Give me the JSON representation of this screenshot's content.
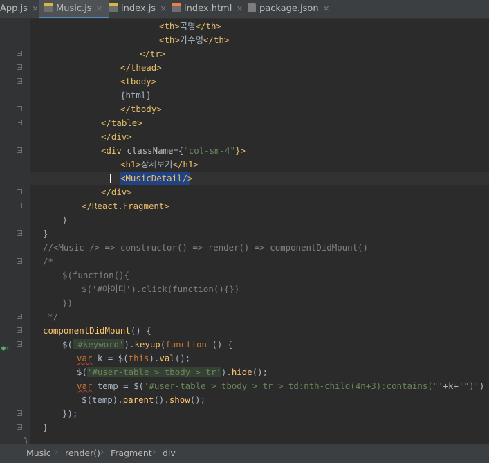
{
  "tabs": [
    {
      "label": "App.js",
      "icon": "js-file-icon",
      "active": false
    },
    {
      "label": "Music.js",
      "icon": "js-file-icon",
      "active": true
    },
    {
      "label": "index.js",
      "icon": "js-file-icon",
      "active": false
    },
    {
      "label": "index.html",
      "icon": "html-file-icon",
      "active": false
    },
    {
      "label": "package.json",
      "icon": "json-file-icon",
      "active": false
    }
  ],
  "tab_close_glyph": "×",
  "code": {
    "l1": {
      "open": "<th>",
      "text": "곡명",
      "close": "</th>"
    },
    "l2": {
      "open": "<th>",
      "text": "가수명",
      "close": "</th>"
    },
    "l3": "</tr>",
    "l4": "</thead>",
    "l5": "<tbody>",
    "l6": "{html}",
    "l7": "</tbody>",
    "l8": "</table>",
    "l9": "</div>",
    "l10": {
      "open": "<div ",
      "attr": "className",
      "eq": "={",
      "str": "\"col-sm-4\"",
      "close": "}>"
    },
    "l11": {
      "open": "<h1>",
      "text": "상세보기",
      "close": "</h1>"
    },
    "l12": "<MusicDetail/>",
    "l13": "</div>",
    "l14": "</React.Fragment>",
    "l15": ")",
    "l16": "}",
    "l17": "//<Music /> => constructor() => render() => componentDidMount()",
    "l18": "/*",
    "l19": "$(function(){",
    "l20": "$('#아이디').click(function(){})",
    "l21": "})",
    "l22": "*/",
    "l23": {
      "name": "componentDidMount",
      "rest": "() {"
    },
    "l24": {
      "a": "$(",
      "b": "'#keyword'",
      "c": ").",
      "d": "keyup",
      "e": "(",
      "f": "function",
      "g": " () {"
    },
    "l25": {
      "var": "var",
      "a": " k = $(",
      "this": "this",
      "b": ").",
      "fn": "val",
      "c": "();"
    },
    "l26": {
      "a": "$(",
      "s1": "'#user-table > tbody > tr'",
      "b": ").",
      "fn": "hide",
      "c": "();"
    },
    "l27": {
      "var": "var",
      "a": " temp = $(",
      "s1": "'#user-table > tbody > tr > td:nth-child(4n+3):contains(\"'",
      "b": "+k+",
      "s2": "'\")'",
      "c": ")"
    },
    "l28": {
      "a": "$(temp).",
      "fn1": "parent",
      "b": "().",
      "fn2": "show",
      "c": "();"
    },
    "l29": "});",
    "l30": "}",
    "l31": "}"
  },
  "breadcrumbs": [
    "Music",
    "render()",
    "Fragment",
    "div"
  ],
  "colors": {
    "background": "#2b2b2b",
    "tag": "#e8bf6a",
    "string": "#6a8759",
    "keyword": "#cc7832",
    "comment": "#808080",
    "selection": "#214283"
  }
}
